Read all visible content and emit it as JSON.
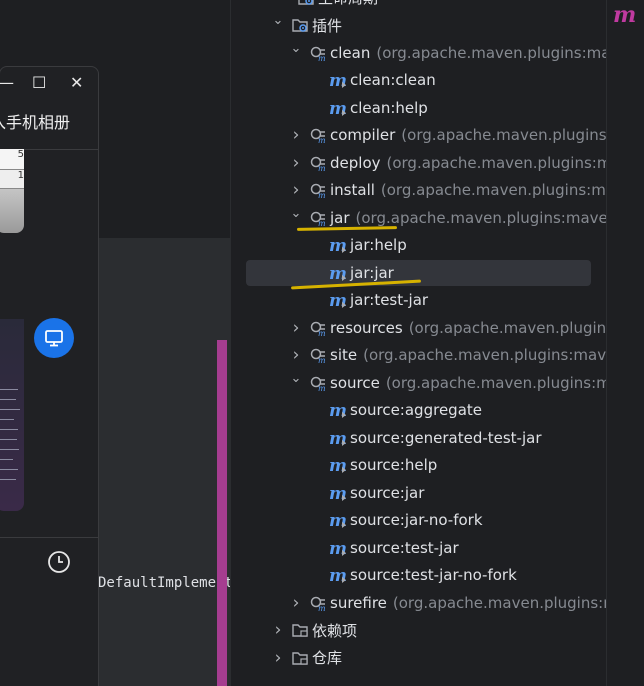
{
  "phone_window": {
    "title": "入手机相册",
    "min_glyph": "—",
    "max_glyph": "☐",
    "close_glyph": "✕",
    "thumb1_val_a": "5",
    "thumb1_val_b": "1"
  },
  "editor": {
    "code_fragment": "DefaultImplement"
  },
  "tree": {
    "top_partial": "生命周期",
    "plugins_label": "插件",
    "deps_label": "依赖项",
    "repo_label": "仓库",
    "plugins": [
      {
        "name": "clean",
        "group": "(org.apache.maven.plugins:mav",
        "expanded": true,
        "goals": [
          "clean:clean",
          "clean:help"
        ]
      },
      {
        "name": "compiler",
        "group": "(org.apache.maven.plugins:m",
        "expanded": false,
        "goals": []
      },
      {
        "name": "deploy",
        "group": "(org.apache.maven.plugins:ma",
        "expanded": false,
        "goals": []
      },
      {
        "name": "install",
        "group": "(org.apache.maven.plugins:mav",
        "expanded": false,
        "goals": []
      },
      {
        "name": "jar",
        "group": "(org.apache.maven.plugins:maven-",
        "expanded": true,
        "goals": [
          "jar:help",
          "jar:jar",
          "jar:test-jar"
        ]
      },
      {
        "name": "resources",
        "group": "(org.apache.maven.plugins",
        "expanded": false,
        "goals": []
      },
      {
        "name": "site",
        "group": "(org.apache.maven.plugins:maven",
        "expanded": false,
        "goals": []
      },
      {
        "name": "source",
        "group": "(org.apache.maven.plugins:ma",
        "expanded": true,
        "goals": [
          "source:aggregate",
          "source:generated-test-jar",
          "source:help",
          "source:jar",
          "source:jar-no-fork",
          "source:test-jar",
          "source:test-jar-no-fork"
        ]
      },
      {
        "name": "surefire",
        "group": "(org.apache.maven.plugins:m",
        "expanded": false,
        "goals": []
      }
    ],
    "selected_goal": "jar:jar"
  },
  "right_strip": {
    "icon_glyph": "m"
  },
  "colors": {
    "background": "#1e1f22",
    "selection": "#33353b",
    "accent_blue": "#1a73e8",
    "annotation_yellow": "#d6b200",
    "maven_purple": "#c03aa0"
  },
  "icons": [
    "folder-gear-icon",
    "plugin-icon",
    "maven-goal-icon",
    "chevron-down-icon",
    "chevron-right-icon",
    "monitor-icon",
    "clock-icon",
    "folder-icon"
  ]
}
